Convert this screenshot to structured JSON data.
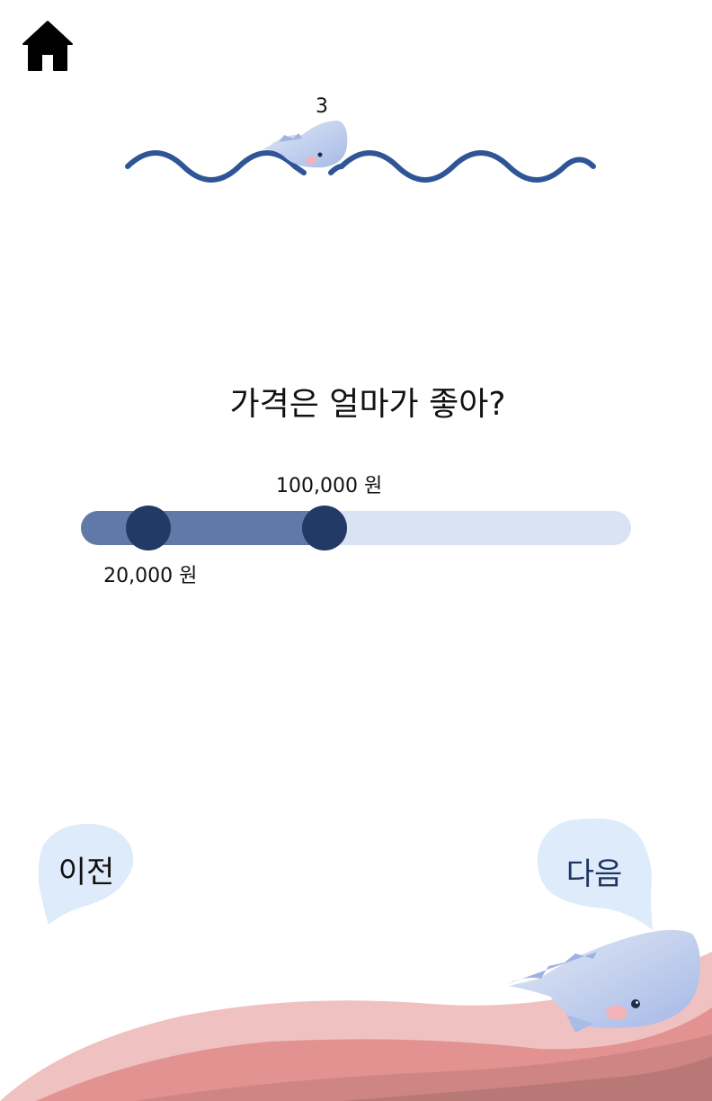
{
  "header": {
    "home_icon": "home-icon"
  },
  "progress": {
    "current_step": "3"
  },
  "question": {
    "text": "가격은 얼마가 좋아?"
  },
  "price_slider": {
    "min_label": "20,000 원",
    "max_label": "100,000 원",
    "lower_fraction": 0.123,
    "upper_fraction": 0.443
  },
  "navigation": {
    "prev_label": "이전",
    "next_label": "다음"
  },
  "colors": {
    "wave": "#2f5597",
    "slider_track": "#dae3f3",
    "slider_fill": "#6179a6",
    "slider_thumb": "#213a66",
    "bubble": "#ddebfb",
    "next_text": "#1f3662"
  }
}
